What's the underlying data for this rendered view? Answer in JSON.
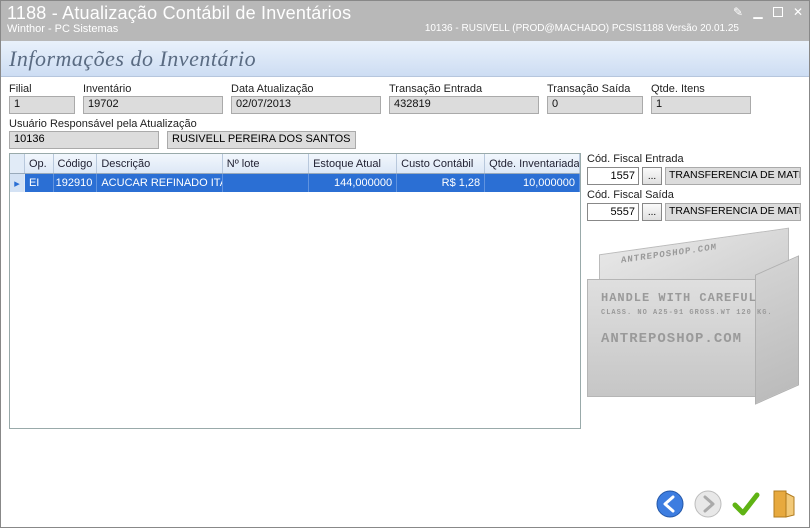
{
  "window": {
    "title": "1188 - Atualização Contábil de Inventários",
    "subtitle": "Winthor - PC Sistemas",
    "right_info": "10136 - RUSIVELL (PROD@MACHADO)   PCSIS1188   Versão 20.01.25"
  },
  "section_title": "Informações do Inventário",
  "fields": {
    "filial": {
      "label": "Filial",
      "value": "1"
    },
    "inventario": {
      "label": "Inventário",
      "value": "19702"
    },
    "data_atualizacao": {
      "label": "Data Atualização",
      "value": "02/07/2013"
    },
    "transacao_entrada": {
      "label": "Transação Entrada",
      "value": "432819"
    },
    "transacao_saida": {
      "label": "Transação Saída",
      "value": "0"
    },
    "qtde_itens": {
      "label": "Qtde. Itens",
      "value": "1"
    },
    "usuario_resp_label": "Usuário Responsável pela Atualização",
    "usuario_resp_code": "10136",
    "usuario_resp_name": "RUSIVELL PEREIRA DOS SANTOS"
  },
  "grid": {
    "columns": [
      "Op.",
      "Código",
      "Descrição",
      "Nº lote",
      "Estoque Atual",
      "Custo Contábil",
      "Qtde. Inventariada"
    ],
    "rows": [
      {
        "indicator": "▸",
        "op": "EI",
        "codigo": "192910",
        "descricao": "ACUCAR REFINADO ITAM",
        "lote": "",
        "estoque": "144,000000",
        "custo": "R$ 1,28",
        "qtde": "10,000000"
      }
    ]
  },
  "side": {
    "entrada": {
      "label": "Cód. Fiscal Entrada",
      "value": "1557",
      "desc": "TRANSFERENCIA DE MATER"
    },
    "saida": {
      "label": "Cód. Fiscal Saída",
      "value": "5557",
      "desc": "TRANSFERENCIA DE MATER"
    }
  },
  "crate": {
    "line1": "ANTREPOSHOP.COM",
    "line2": "HANDLE WITH CAREFUL",
    "line3": "CLASS. NO A25-91   GROSS.WT 120 KG.",
    "line4": "ANTREPOSHOP.COM"
  }
}
